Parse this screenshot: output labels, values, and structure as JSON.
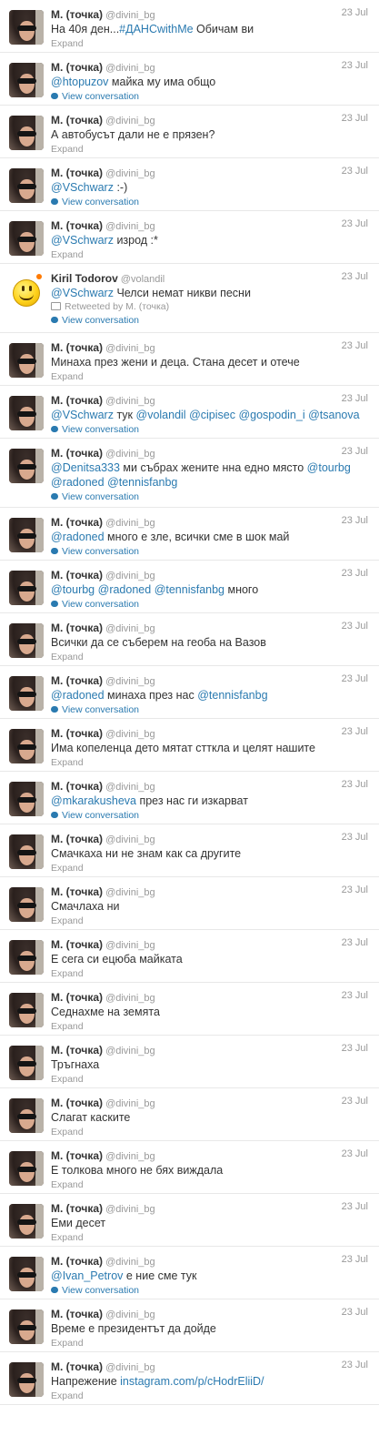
{
  "timeline": {
    "tweets": [
      {
        "fullname": "M. (точка)",
        "username": "@divini_bg",
        "time": "23 Jul",
        "parts": [
          {
            "t": "На 40я ден..."
          },
          {
            "t": "#ДАНСwithMe",
            "link": true
          },
          {
            "t": " Обичам ви"
          }
        ],
        "action": "Expand",
        "action_type": "expand"
      },
      {
        "fullname": "M. (точка)",
        "username": "@divini_bg",
        "time": "23 Jul",
        "parts": [
          {
            "t": "@htopuzov",
            "link": true
          },
          {
            "t": " майка му има общо"
          }
        ],
        "action": "View conversation",
        "action_type": "view"
      },
      {
        "fullname": "M. (точка)",
        "username": "@divini_bg",
        "time": "23 Jul",
        "parts": [
          {
            "t": "А автобусът дали не е прязен?"
          }
        ],
        "action": "Expand",
        "action_type": "expand"
      },
      {
        "fullname": "M. (точка)",
        "username": "@divini_bg",
        "time": "23 Jul",
        "parts": [
          {
            "t": "@VSchwarz",
            "link": true
          },
          {
            "t": " :-)"
          }
        ],
        "action": "View conversation",
        "action_type": "view"
      },
      {
        "fullname": "M. (точка)",
        "username": "@divini_bg",
        "time": "23 Jul",
        "parts": [
          {
            "t": "@VSchwarz",
            "link": true
          },
          {
            "t": " изрод :*"
          }
        ],
        "action": "Expand",
        "action_type": "expand"
      },
      {
        "fullname": "Kiril Todorov",
        "username": "@volandil",
        "time": "23 Jul",
        "avatar": "smiley",
        "parts": [
          {
            "t": "@VSchwarz",
            "link": true
          },
          {
            "t": " Челси немат никви песни"
          }
        ],
        "retweet": "Retweeted by M. (точка)",
        "action": "View conversation",
        "action_type": "view"
      },
      {
        "fullname": "M. (точка)",
        "username": "@divini_bg",
        "time": "23 Jul",
        "parts": [
          {
            "t": "Минаха през жени и деца. Стана десет и отече"
          }
        ],
        "action": "Expand",
        "action_type": "expand"
      },
      {
        "fullname": "M. (точка)",
        "username": "@divini_bg",
        "time": "23 Jul",
        "parts": [
          {
            "t": "@VSchwarz",
            "link": true
          },
          {
            "t": " тук "
          },
          {
            "t": "@volandil",
            "link": true
          },
          {
            "t": " "
          },
          {
            "t": "@cipisec",
            "link": true
          },
          {
            "t": " "
          },
          {
            "t": "@gospodin_i",
            "link": true
          },
          {
            "t": " "
          },
          {
            "t": "@tsanova",
            "link": true
          }
        ],
        "action": "View conversation",
        "action_type": "view"
      },
      {
        "fullname": "M. (точка)",
        "username": "@divini_bg",
        "time": "23 Jul",
        "parts": [
          {
            "t": "@Denitsa333",
            "link": true
          },
          {
            "t": " ми събрах жените нна едно място "
          },
          {
            "t": "@tourbg",
            "link": true
          }
        ],
        "parts2": [
          {
            "t": "@radoned",
            "link": true
          },
          {
            "t": " "
          },
          {
            "t": "@tennisfanbg",
            "link": true
          }
        ],
        "action": "View conversation",
        "action_type": "view"
      },
      {
        "fullname": "M. (точка)",
        "username": "@divini_bg",
        "time": "23 Jul",
        "parts": [
          {
            "t": "@radoned",
            "link": true
          },
          {
            "t": " много е зле, всички сме в шок май"
          }
        ],
        "action": "View conversation",
        "action_type": "view"
      },
      {
        "fullname": "M. (точка)",
        "username": "@divini_bg",
        "time": "23 Jul",
        "parts": [
          {
            "t": "@tourbg",
            "link": true
          },
          {
            "t": " "
          },
          {
            "t": "@radoned",
            "link": true
          },
          {
            "t": " "
          },
          {
            "t": "@tennisfanbg",
            "link": true
          },
          {
            "t": " много"
          }
        ],
        "action": "View conversation",
        "action_type": "view"
      },
      {
        "fullname": "M. (точка)",
        "username": "@divini_bg",
        "time": "23 Jul",
        "parts": [
          {
            "t": "Всички да се съберем на геоба на Вазов"
          }
        ],
        "action": "Expand",
        "action_type": "expand"
      },
      {
        "fullname": "M. (точка)",
        "username": "@divini_bg",
        "time": "23 Jul",
        "parts": [
          {
            "t": "@radoned",
            "link": true
          },
          {
            "t": " минаха през нас "
          },
          {
            "t": "@tennisfanbg",
            "link": true
          }
        ],
        "action": "View conversation",
        "action_type": "view"
      },
      {
        "fullname": "M. (точка)",
        "username": "@divini_bg",
        "time": "23 Jul",
        "parts": [
          {
            "t": "Има копеленца дето мятат стткла и целят нашите"
          }
        ],
        "action": "Expand",
        "action_type": "expand"
      },
      {
        "fullname": "M. (точка)",
        "username": "@divini_bg",
        "time": "23 Jul",
        "parts": [
          {
            "t": "@mkarakusheva",
            "link": true
          },
          {
            "t": " през нас ги изкарват"
          }
        ],
        "action": "View conversation",
        "action_type": "view"
      },
      {
        "fullname": "M. (точка)",
        "username": "@divini_bg",
        "time": "23 Jul",
        "parts": [
          {
            "t": "Смачкаха ни не знам как са другите"
          }
        ],
        "action": "Expand",
        "action_type": "expand"
      },
      {
        "fullname": "M. (точка)",
        "username": "@divini_bg",
        "time": "23 Jul",
        "parts": [
          {
            "t": "Смачлаха ни"
          }
        ],
        "action": "Expand",
        "action_type": "expand"
      },
      {
        "fullname": "M. (точка)",
        "username": "@divini_bg",
        "time": "23 Jul",
        "parts": [
          {
            "t": "Е сега си ецюба майката"
          }
        ],
        "action": "Expand",
        "action_type": "expand"
      },
      {
        "fullname": "M. (точка)",
        "username": "@divini_bg",
        "time": "23 Jul",
        "parts": [
          {
            "t": "Седнахме на земята"
          }
        ],
        "action": "Expand",
        "action_type": "expand"
      },
      {
        "fullname": "M. (точка)",
        "username": "@divini_bg",
        "time": "23 Jul",
        "parts": [
          {
            "t": "Тръгнаха"
          }
        ],
        "action": "Expand",
        "action_type": "expand"
      },
      {
        "fullname": "M. (точка)",
        "username": "@divini_bg",
        "time": "23 Jul",
        "parts": [
          {
            "t": "Слагат каските"
          }
        ],
        "action": "Expand",
        "action_type": "expand"
      },
      {
        "fullname": "M. (точка)",
        "username": "@divini_bg",
        "time": "23 Jul",
        "parts": [
          {
            "t": "Е толкова много не бях виждала"
          }
        ],
        "action": "Expand",
        "action_type": "expand"
      },
      {
        "fullname": "M. (точка)",
        "username": "@divini_bg",
        "time": "23 Jul",
        "parts": [
          {
            "t": "Еми десет"
          }
        ],
        "action": "Expand",
        "action_type": "expand"
      },
      {
        "fullname": "M. (точка)",
        "username": "@divini_bg",
        "time": "23 Jul",
        "parts": [
          {
            "t": "@Ivan_Petrov",
            "link": true
          },
          {
            "t": " е ние сме тук"
          }
        ],
        "action": "View conversation",
        "action_type": "view"
      },
      {
        "fullname": "M. (точка)",
        "username": "@divini_bg",
        "time": "23 Jul",
        "parts": [
          {
            "t": "Време е президентът да дойде"
          }
        ],
        "action": "Expand",
        "action_type": "expand"
      },
      {
        "fullname": "M. (точка)",
        "username": "@divini_bg",
        "time": "23 Jul",
        "parts": [
          {
            "t": "Напрежение "
          },
          {
            "t": "instagram.com/p/cHodrEliiD/",
            "link": true
          }
        ],
        "action": "Expand",
        "action_type": "expand"
      }
    ]
  }
}
